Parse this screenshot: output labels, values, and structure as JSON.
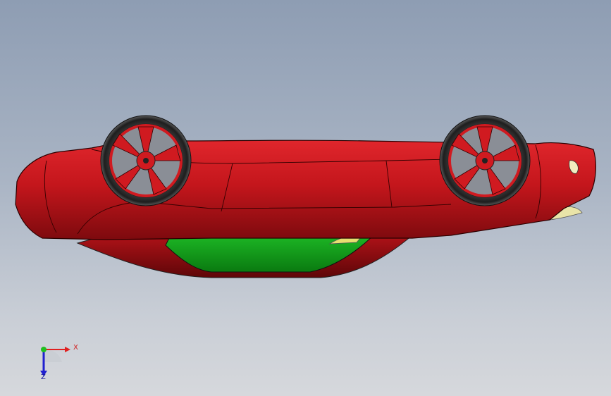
{
  "triad": {
    "x_label": "X",
    "z_label": "Z",
    "colors": {
      "x": "#e02020",
      "y": "#20c020",
      "z": "#2020d0"
    }
  },
  "model": {
    "body_color": "#c4161c",
    "glass_color": "#0d9a14",
    "tire_color": "#2b2b2b",
    "rim_color": "#d01a20",
    "hub_color": "#8a8e96",
    "icons": [
      "car-body",
      "front-wheel",
      "rear-wheel",
      "windshield-glass"
    ]
  }
}
